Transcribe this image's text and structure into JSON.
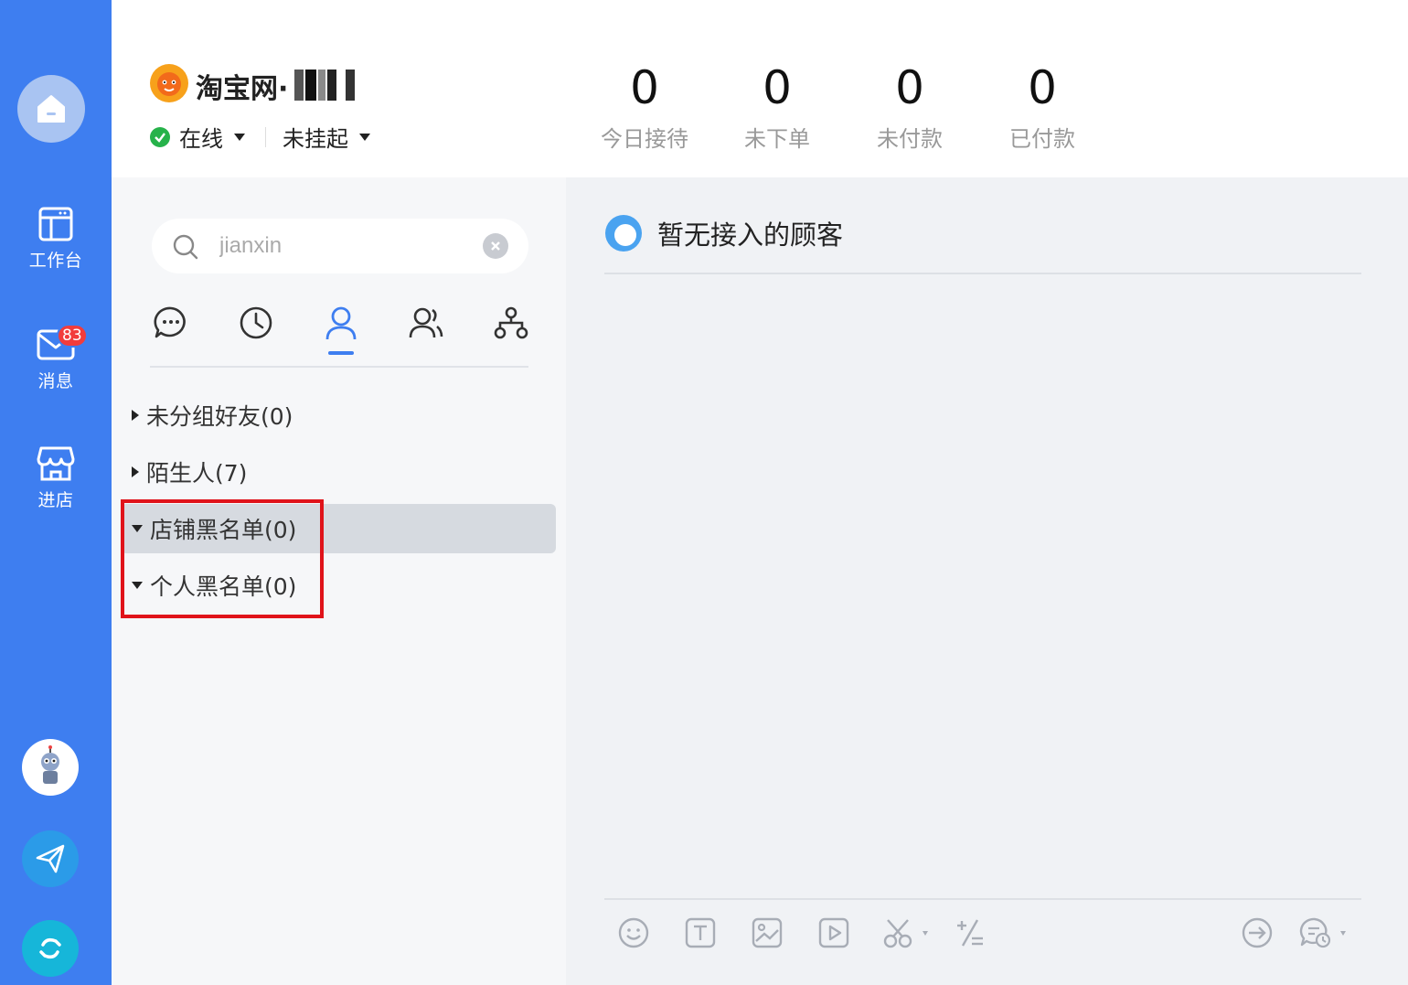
{
  "sidebar": {
    "items": [
      {
        "label": "工作台",
        "icon": "workbench-icon"
      },
      {
        "label": "消息",
        "icon": "mail-icon",
        "badge": "83"
      },
      {
        "label": "进店",
        "icon": "store-icon"
      }
    ]
  },
  "header": {
    "shop_name": "淘宝网·",
    "status": "在线",
    "suspend": "未挂起",
    "stats": [
      {
        "value": "0",
        "label": "今日接待"
      },
      {
        "value": "0",
        "label": "未下单"
      },
      {
        "value": "0",
        "label": "未付款"
      },
      {
        "value": "0",
        "label": "已付款"
      }
    ]
  },
  "contacts": {
    "search": {
      "value": "jianxin"
    },
    "tabs": [
      "chat-tab",
      "recent-tab",
      "friends-tab",
      "groups-tab",
      "org-tab"
    ],
    "active_tab": 2,
    "groups": [
      {
        "label": "未分组好友(0)",
        "expanded": false
      },
      {
        "label": "陌生人(7)",
        "expanded": false
      },
      {
        "label": "店铺黑名单(0)",
        "expanded": true
      },
      {
        "label": "个人黑名单(0)",
        "expanded": true
      }
    ]
  },
  "chat": {
    "empty_title": "暂无接入的顾客"
  },
  "colors": {
    "rail": "#3e7ef0",
    "accent": "#3e7ef0",
    "online": "#26b24a",
    "badge": "#f23c3c",
    "highlight": "#e0131a"
  }
}
